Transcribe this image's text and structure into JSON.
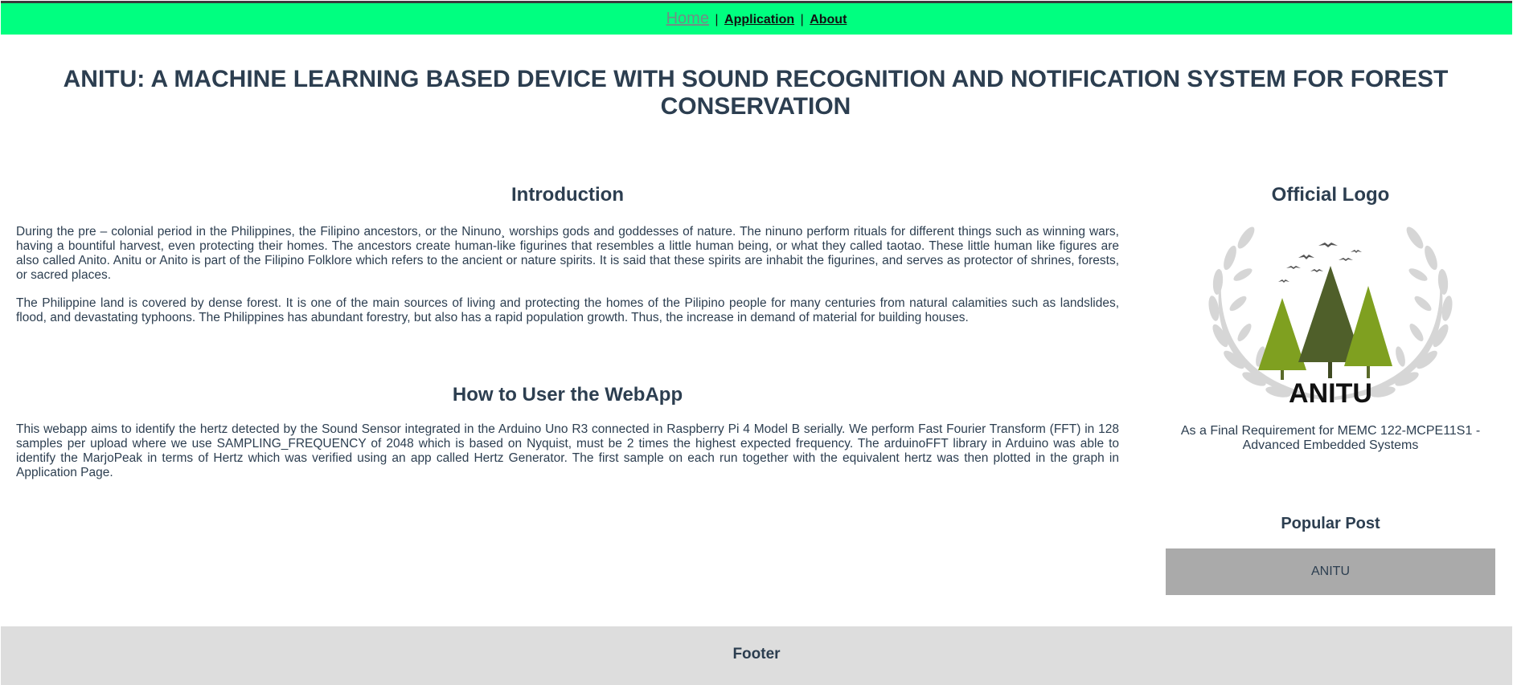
{
  "nav": {
    "items": [
      {
        "label": "Home"
      },
      {
        "label": "Application"
      },
      {
        "label": "About"
      }
    ],
    "separator": "|"
  },
  "header": {
    "title_line1": "ANITU: A MACHINE LEARNING BASED DEVICE WITH SOUND RECOGNITION AND NOTIFICATION SYSTEM FOR FOREST",
    "title_line2": "CONSERVATION"
  },
  "main": {
    "intro_heading": "Introduction",
    "intro_p1": "During the pre – colonial period in the Philippines, the Filipino ancestors, or the Ninuno¸ worships gods and goddesses of nature. The ninuno perform rituals for different things such as winning wars, having a bountiful harvest, even protecting their homes. The ancestors create human-like figurines that resembles a little human being, or what they called taotao. These little human like figures are also called Anito. Anitu or Anito is part of the Filipino Folklore which refers to the ancient or nature spirits. It is said that these spirits are inhabit the figurines, and serves as protector of shrines, forests, or sacred places.",
    "intro_p2": "The Philippine land is covered by dense forest. It is one of the main sources of living and protecting the homes of the Pilipino people for many centuries from natural calamities such as landslides, flood, and devastating typhoons. The Philippines has abundant forestry, but also has a rapid population growth. Thus, the increase in demand of material for building houses.",
    "howto_heading": "How to User the WebApp",
    "howto_p": "This webapp aims to identify the hertz detected by the Sound Sensor integrated in the Arduino Uno R3 connected in Raspberry Pi 4 Model B serially. We perform Fast Fourier Transform (FFT) in 128 samples per upload where we use SAMPLING_FREQUENCY of 2048 which is based on Nyquist, must be 2 times the highest expected frequency. The arduinoFFT library in Arduino was able to identify the MarjoPeak in terms of Hertz which was verified using an app called Hertz Generator. The first sample on each run together with the equivalent hertz was then plotted in the graph in Application Page."
  },
  "sidebar": {
    "logo_heading": "Official Logo",
    "logo_text": "ANITU",
    "logo_colors": {
      "light_tree": "#7fa020",
      "dark_tree": "#4f5f2a",
      "laurel": "#d6d6d6",
      "text": "#111111"
    },
    "caption": "As a Final Requirement for MEMC 122-MCPE11S1 - Advanced Embedded Systems",
    "popular_heading": "Popular Post",
    "popular_items": [
      {
        "label": "ANITU"
      }
    ]
  },
  "footer": {
    "label": "Footer"
  },
  "colors": {
    "nav_bg": "#00ff80",
    "text": "#2c3e50",
    "footer_bg": "#dddddd",
    "popular_bg": "#aaaaaa"
  }
}
